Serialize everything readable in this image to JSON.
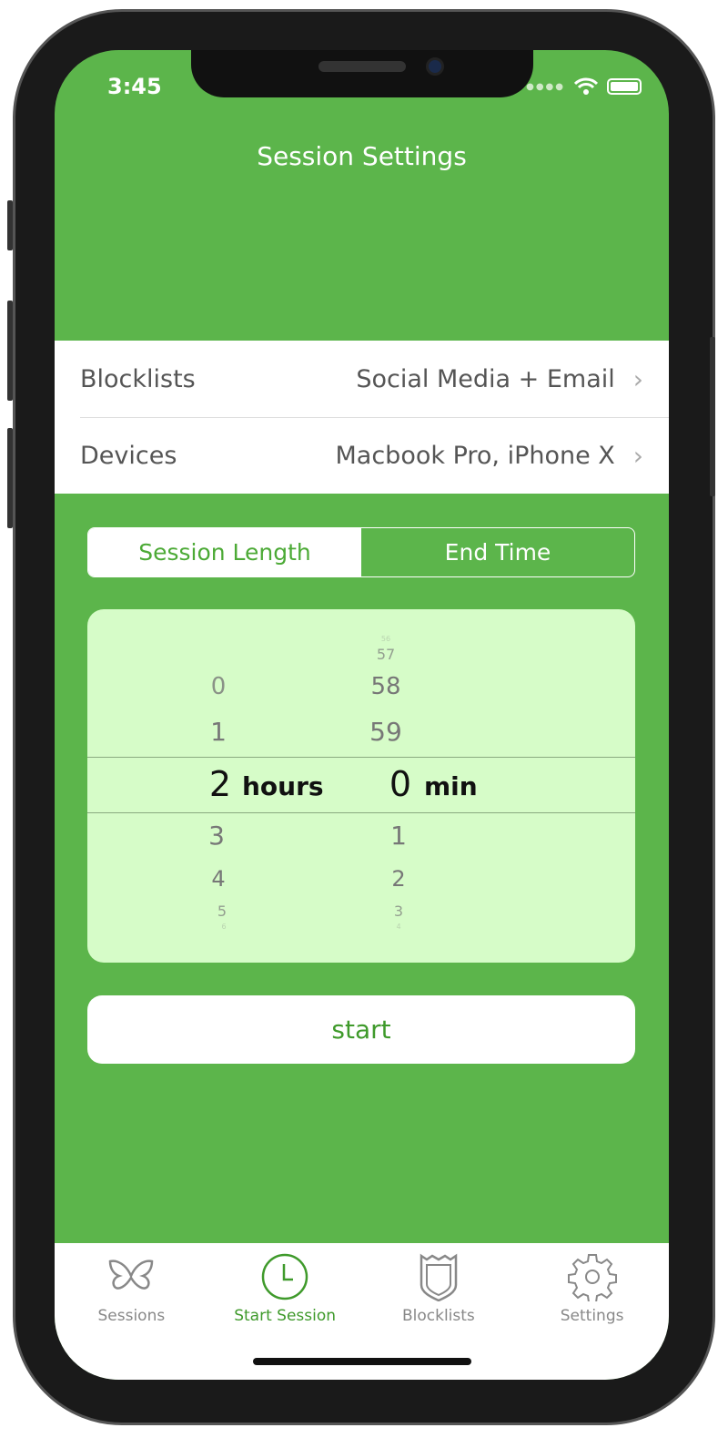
{
  "status_bar": {
    "time": "3:45"
  },
  "header": {
    "title": "Session Settings"
  },
  "settings": [
    {
      "label": "Blocklists",
      "value": "Social Media + Email"
    },
    {
      "label": "Devices",
      "value": "Macbook Pro, iPhone X"
    }
  ],
  "segmented": {
    "options": [
      "Session Length",
      "End Time"
    ],
    "selected": "Session Length"
  },
  "picker": {
    "hours": {
      "above": [
        "0",
        "1"
      ],
      "selected": "2",
      "below": [
        "3",
        "4",
        "5",
        "6"
      ],
      "unit": "hours"
    },
    "minutes": {
      "above": [
        "56",
        "57",
        "58",
        "59"
      ],
      "selected": "0",
      "below": [
        "1",
        "2",
        "3",
        "4"
      ],
      "unit": "min"
    }
  },
  "start_label": "start",
  "tabs": [
    {
      "label": "Sessions",
      "icon": "butterfly-icon"
    },
    {
      "label": "Start Session",
      "icon": "clock-icon",
      "active": true
    },
    {
      "label": "Blocklists",
      "icon": "shield-icon"
    },
    {
      "label": "Settings",
      "icon": "gear-icon"
    }
  ],
  "colors": {
    "primary": "#5cb54b",
    "picker_bg": "#d6fcc8",
    "active": "#3f9a2b"
  }
}
